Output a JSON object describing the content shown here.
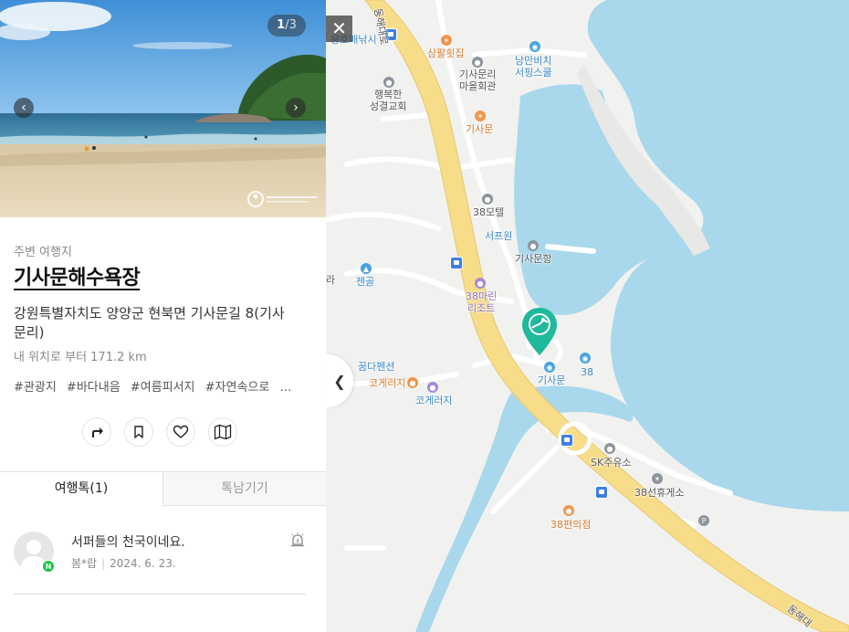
{
  "photo": {
    "counter_current": "1",
    "counter_total": "/3",
    "prev_icon": "chevron-left-icon",
    "next_icon": "chevron-right-icon"
  },
  "place": {
    "category": "주변 여행지",
    "name": "기사문해수욕장",
    "address": "강원특별자치도 양양군 현북면 기사문길 8(기사문리)",
    "distance": "내 위치로 부터 171.2 km",
    "tags": [
      "#관광지",
      "#바다내음",
      "#여름피서지",
      "#자연속으로",
      "…"
    ]
  },
  "actions": [
    {
      "name": "directions-button",
      "icon": "directions-arrow-icon"
    },
    {
      "name": "bookmark-button",
      "icon": "bookmark-icon"
    },
    {
      "name": "like-button",
      "icon": "heart-icon"
    },
    {
      "name": "map-button",
      "icon": "map-icon"
    }
  ],
  "tabs": [
    {
      "label": "여행톡(1)",
      "active": true
    },
    {
      "label": "톡남기기",
      "active": false
    }
  ],
  "review": {
    "text": "서퍼들의 천국이네요.",
    "author": "봄*랍",
    "date": "2024. 6. 23.",
    "badge": "N"
  },
  "map": {
    "labels": [
      {
        "text": "용호매낚시",
        "cls": "blue"
      },
      {
        "text": "삼팔횟집",
        "cls": "orange"
      },
      {
        "text": "낭만비치\n서핑스쿨",
        "cls": "blue"
      },
      {
        "text": "기사문리\n마을회관",
        "cls": "dark"
      },
      {
        "text": "행복한\n성결교회",
        "cls": "dark"
      },
      {
        "text": "기사문",
        "cls": "orange"
      },
      {
        "text": "38모텔",
        "cls": "dark"
      },
      {
        "text": "서프원",
        "cls": "blue"
      },
      {
        "text": "기사문항",
        "cls": "dark"
      },
      {
        "text": "젠골",
        "cls": "blue"
      },
      {
        "text": "38마린\n리조트",
        "cls": "purple"
      },
      {
        "text": "꿈다펜션",
        "cls": "blue"
      },
      {
        "text": "코게러지",
        "cls": "orange"
      },
      {
        "text": "코게러지",
        "cls": "blue"
      },
      {
        "text": "기사문",
        "cls": "blue"
      },
      {
        "text": "38",
        "cls": "blue"
      },
      {
        "text": "SK주유소",
        "cls": "dark"
      },
      {
        "text": "38선휴게소",
        "cls": "dark"
      },
      {
        "text": "38편의점",
        "cls": "orange"
      },
      {
        "text": "라",
        "cls": "dark"
      },
      {
        "text": "동해대로",
        "cls": "dark"
      },
      {
        "text": "동해대",
        "cls": "dark"
      }
    ],
    "accent_color": "#1fb99b",
    "water_color": "#a9d8ec",
    "road_color": "#f7dc8a"
  }
}
